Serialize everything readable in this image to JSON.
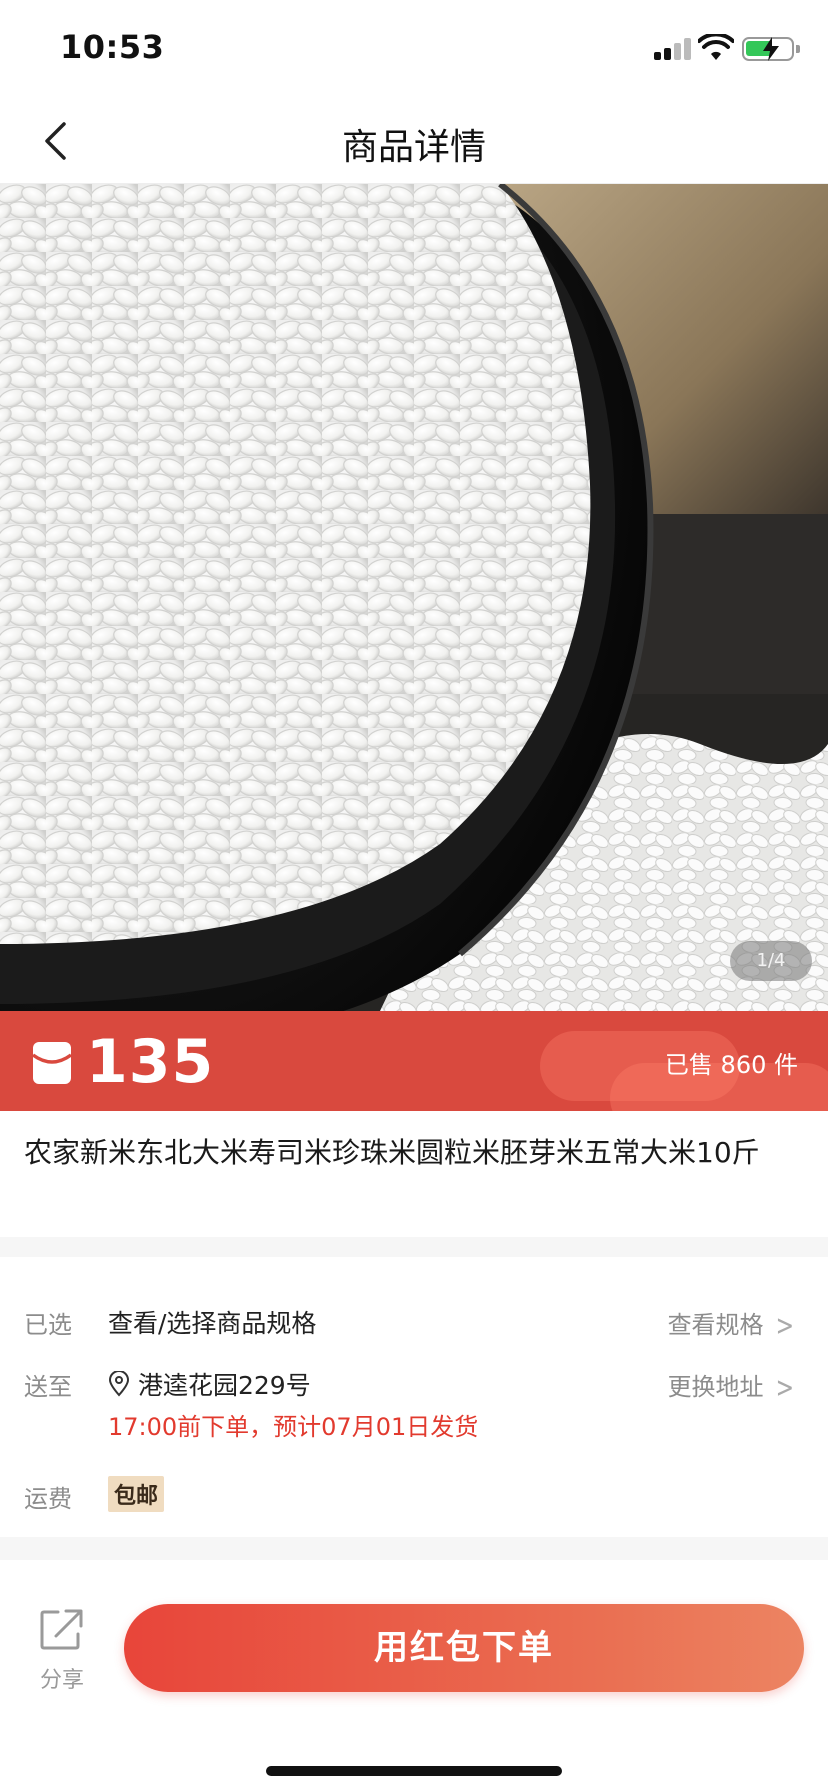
{
  "status": {
    "time": "10:53"
  },
  "nav": {
    "title": "商品详情"
  },
  "gallery": {
    "counter": "1/4"
  },
  "price": {
    "amount": "135",
    "sold": "已售 860 件"
  },
  "product": {
    "title": "农家新米东北大米寿司米珍珠米圆粒米胚芽米五常大米10斤"
  },
  "spec": {
    "selected_label": "已选",
    "selected_value": "查看/选择商品规格",
    "selected_action": "查看规格",
    "ship_label": "送至",
    "ship_address": "港逵花园229号",
    "ship_action": "更换地址",
    "ship_note": "17:00前下单，预计07月01日发货",
    "fee_label": "运费",
    "fee_badge": "包邮"
  },
  "bottom": {
    "share_label": "分享",
    "order_label": "用红包下单"
  },
  "colors": {
    "accent": "#d9493e",
    "note": "#e23a2e",
    "badge_bg": "#f0dcc0"
  }
}
